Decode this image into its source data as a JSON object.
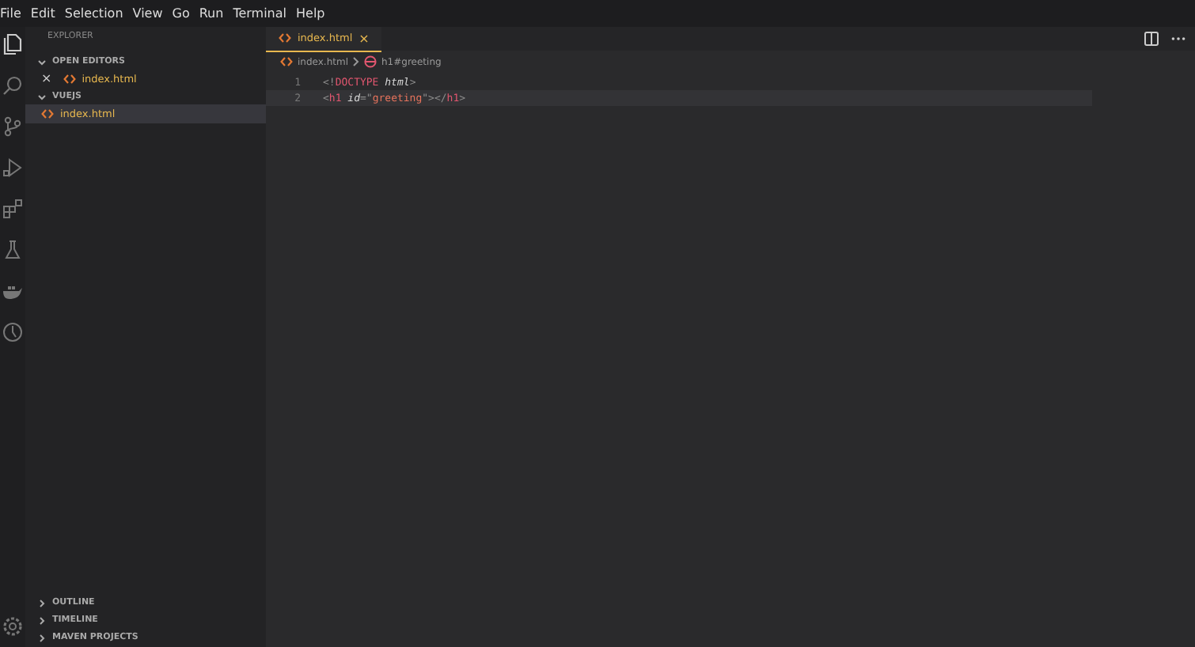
{
  "menu": [
    "File",
    "Edit",
    "Selection",
    "View",
    "Go",
    "Run",
    "Terminal",
    "Help"
  ],
  "sidebar": {
    "title": "EXPLORER",
    "sections": [
      {
        "label": "OPEN EDITORS",
        "expanded": true,
        "items": [
          {
            "name": "index.html",
            "close": "×",
            "selected": false
          }
        ]
      },
      {
        "label": "VUEJS",
        "expanded": true,
        "items": [
          {
            "name": "index.html",
            "selected": true
          }
        ]
      }
    ],
    "bottom_sections": [
      {
        "label": "OUTLINE",
        "expanded": false
      },
      {
        "label": "TIMELINE",
        "expanded": false
      },
      {
        "label": "MAVEN PROJECTS",
        "expanded": false
      }
    ]
  },
  "tabs": [
    {
      "label": "index.html",
      "close": "×",
      "selected": true
    }
  ],
  "breadcrumb": {
    "file": "index.html",
    "symbol": "h1#greeting"
  },
  "lines": [
    {
      "number": "1",
      "tokens": [
        {
          "kind": "punct",
          "text": "<!"
        },
        {
          "kind": "keyword",
          "text": "DOCTYPE"
        },
        {
          "kind": "attr",
          "text": " html"
        },
        {
          "kind": "punct",
          "text": ">"
        }
      ]
    },
    {
      "number": "2",
      "tokens": [
        {
          "kind": "punct",
          "text": "<"
        },
        {
          "kind": "keyword",
          "text": "h1"
        },
        {
          "kind": "attr",
          "text": " id"
        },
        {
          "kind": "punct",
          "text": "=\""
        },
        {
          "kind": "string",
          "text": "greeting"
        },
        {
          "kind": "punct",
          "text": "\"></"
        },
        {
          "kind": "keyword",
          "text": "h1"
        },
        {
          "kind": "punct",
          "text": ">"
        }
      ]
    }
  ]
}
